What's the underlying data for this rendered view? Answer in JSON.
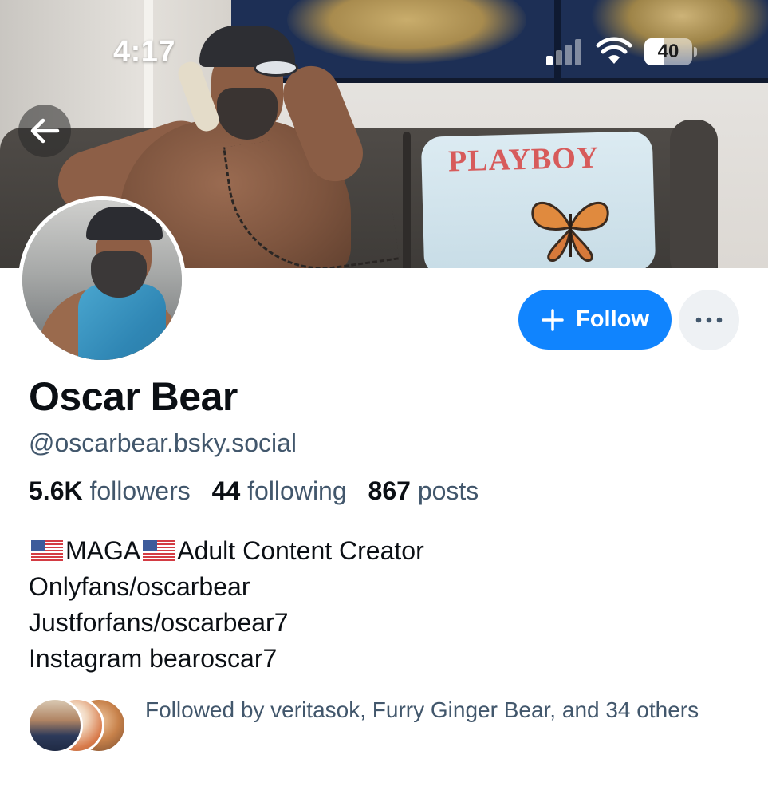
{
  "status_bar": {
    "time": "4:17",
    "battery_text": "40",
    "battery_level": 0.4,
    "icons": [
      "signal-icon",
      "wifi-icon",
      "battery-icon"
    ]
  },
  "banner": {
    "pillow_text": "PLAYBOY"
  },
  "navigation": {
    "back_icon": "arrow-left-icon"
  },
  "actions": {
    "follow_icon": "plus-icon",
    "follow_label": "Follow",
    "more_icon": "ellipsis-icon"
  },
  "profile": {
    "display_name": "Oscar Bear",
    "handle": "@oscarbear.bsky.social",
    "stats": {
      "followers_count": "5.6K",
      "followers_label": "followers",
      "following_count": "44",
      "following_label": "following",
      "posts_count": "867",
      "posts_label": "posts"
    },
    "bio": {
      "line1_text1": "MAGA",
      "line1_text2": "Adult Content Creator",
      "line2": "Onlyfans/oscarbear",
      "line3": "Justforfans/oscarbear7",
      "line4": "Instagram bearoscar7"
    },
    "followed_by": "Followed by veritasok, Furry Ginger Bear, and 34 others"
  },
  "colors": {
    "accent": "#1084fe",
    "secondary_text": "#42576c",
    "primary_text": "#0b0f14",
    "more_button_bg": "#eef1f4"
  }
}
